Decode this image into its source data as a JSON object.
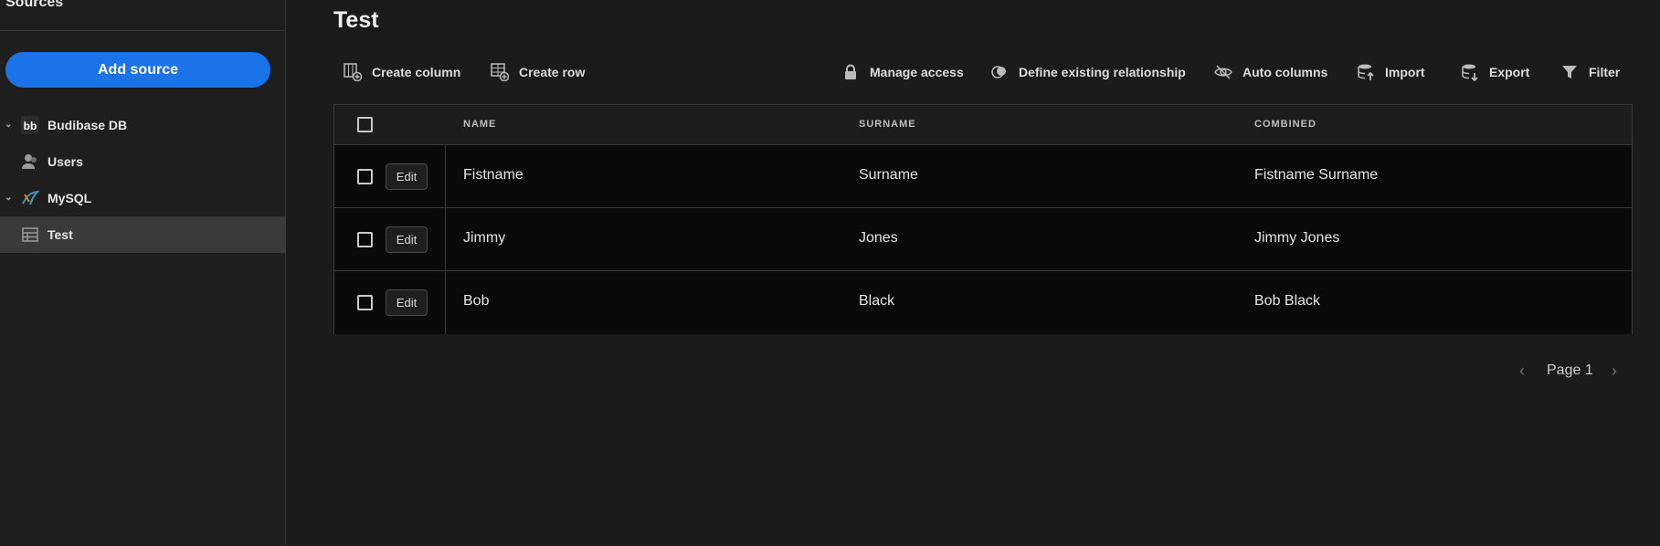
{
  "sidebar": {
    "title": "Sources",
    "add_source": "Add source",
    "items": [
      {
        "label": "Budibase DB",
        "icon": "budibase-logo-icon",
        "expandable": true
      },
      {
        "label": "Users",
        "icon": "users-icon"
      },
      {
        "label": "MySQL",
        "icon": "mysql-icon",
        "expandable": true
      },
      {
        "label": "Test",
        "icon": "table-icon",
        "active": true
      }
    ]
  },
  "main": {
    "title": "Test",
    "toolbar": {
      "create_column": "Create column",
      "create_row": "Create row",
      "manage_access": "Manage access",
      "define_relationship": "Define existing relationship",
      "auto_columns": "Auto columns",
      "import": "Import",
      "export": "Export",
      "filter": "Filter"
    },
    "table": {
      "headers": [
        "NAME",
        "SURNAME",
        "COMBINED"
      ],
      "edit_label": "Edit",
      "rows": [
        {
          "name": "Fistname",
          "surname": "Surname",
          "combined": "Fistname Surname"
        },
        {
          "name": "Jimmy",
          "surname": "Jones",
          "combined": "Jimmy Jones"
        },
        {
          "name": "Bob",
          "surname": "Black",
          "combined": "Bob Black"
        }
      ]
    },
    "pagination": {
      "label": "Page 1"
    }
  },
  "colors": {
    "accent": "#1a73e8",
    "background": "#1b1b1b",
    "active_item": "#3a3a3a"
  }
}
